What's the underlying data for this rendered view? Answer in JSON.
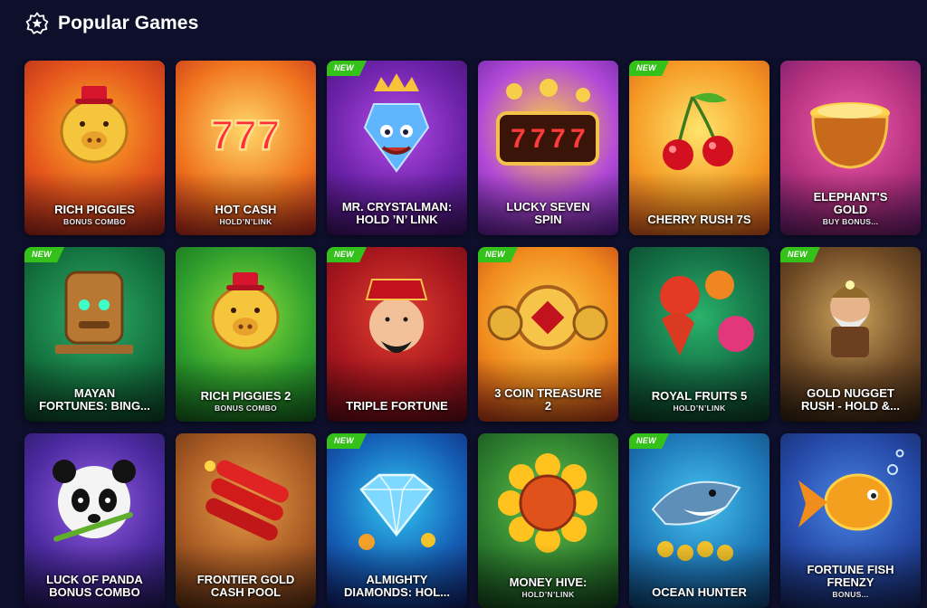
{
  "header": {
    "title": "Popular Games",
    "icon": "star-badge-icon"
  },
  "games": [
    {
      "name": "RICH PIGGIES",
      "sub": "BONUS COMBO",
      "badge": "",
      "bg": [
        "#ffb22b",
        "#e4541c",
        "#a3231a"
      ],
      "icon": "golden-pig-icon"
    },
    {
      "name": "HOT CASH",
      "sub": "HOLD’N’LINK",
      "badge": "",
      "bg": [
        "#ffd86a",
        "#f0741e",
        "#b8241c"
      ],
      "icon": "triple-seven-icon"
    },
    {
      "name": "MR. CRYSTALMAN:\nHOLD ’N’ LINK",
      "sub": "",
      "badge": "NEW",
      "bg": [
        "#b64ce6",
        "#6a21a8",
        "#3a1060"
      ],
      "icon": "crystal-king-icon"
    },
    {
      "name": "LUCKY SEVEN\nSPIN",
      "sub": "",
      "badge": "",
      "bg": [
        "#ffd13f",
        "#b34ad8",
        "#5a1c96"
      ],
      "icon": "slot-reels-icon"
    },
    {
      "name": "CHERRY RUSH 7S",
      "sub": "",
      "badge": "NEW",
      "bg": [
        "#ffe46b",
        "#f59a24",
        "#d2521b"
      ],
      "icon": "cherry-icon"
    },
    {
      "name": "ELEPHANT'S\nGOLD",
      "sub": "BUY BONUS...",
      "badge": "",
      "bg": [
        "#f45fb0",
        "#b3307d",
        "#611a6b"
      ],
      "icon": "gold-pot-icon"
    },
    {
      "name": "MAYAN\nFORTUNES: BING...",
      "sub": "",
      "badge": "NEW",
      "bg": [
        "#2fae6a",
        "#14733f",
        "#0b3d26"
      ],
      "icon": "mayan-totem-icon"
    },
    {
      "name": "RICH PIGGIES 2",
      "sub": "BONUS COMBO",
      "badge": "",
      "bg": [
        "#8ee13b",
        "#2e9e2c",
        "#13601e"
      ],
      "icon": "golden-pig-icon"
    },
    {
      "name": "TRIPLE FORTUNE",
      "sub": "",
      "badge": "NEW",
      "bg": [
        "#e24130",
        "#a7161e",
        "#5c0a14"
      ],
      "icon": "fortune-god-icon"
    },
    {
      "name": "3 COIN TREASURE\n2",
      "sub": "",
      "badge": "NEW",
      "bg": [
        "#ffd24d",
        "#f08a1d",
        "#b53417"
      ],
      "icon": "coins-icon"
    },
    {
      "name": "ROYAL FRUITS 5",
      "sub": "HOLD’N’LINK",
      "badge": "",
      "bg": [
        "#2ab36b",
        "#136b43",
        "#0a3a25"
      ],
      "icon": "fruits-icon"
    },
    {
      "name": "GOLD NUGGET\nRUSH - HOLD &...",
      "sub": "",
      "badge": "NEW",
      "bg": [
        "#caa25b",
        "#6f4a25",
        "#2d1d10"
      ],
      "icon": "miner-icon"
    },
    {
      "name": "LUCK OF PANDA\nBONUS COMBO",
      "sub": "",
      "badge": "",
      "bg": [
        "#9a5fe6",
        "#4b2a9f",
        "#1f1755"
      ],
      "icon": "panda-icon"
    },
    {
      "name": "FRONTIER GOLD\nCASH POOL",
      "sub": "",
      "badge": "",
      "bg": [
        "#e89d46",
        "#a85a24",
        "#5a2d12"
      ],
      "icon": "dynamite-icon"
    },
    {
      "name": "ALMIGHTY\nDIAMONDS: HOL...",
      "sub": "",
      "badge": "NEW",
      "bg": [
        "#31c6f2",
        "#155fb6",
        "#101c66"
      ],
      "icon": "diamond-icon"
    },
    {
      "name": "MONEY HIVE:",
      "sub": "HOLD’N’LINK",
      "badge": "",
      "bg": [
        "#67c44a",
        "#2d7f2f",
        "#14441b"
      ],
      "icon": "sunflower-icon"
    },
    {
      "name": "OCEAN HUNTER",
      "sub": "",
      "badge": "NEW",
      "bg": [
        "#45c3ef",
        "#1e78b8",
        "#0d3d6c"
      ],
      "icon": "shark-icon"
    },
    {
      "name": "FORTUNE FISH\nFRENZY",
      "sub": "BONUS...",
      "badge": "",
      "bg": [
        "#4a86e8",
        "#2549a6",
        "#13225a"
      ],
      "icon": "goldfish-icon"
    }
  ]
}
